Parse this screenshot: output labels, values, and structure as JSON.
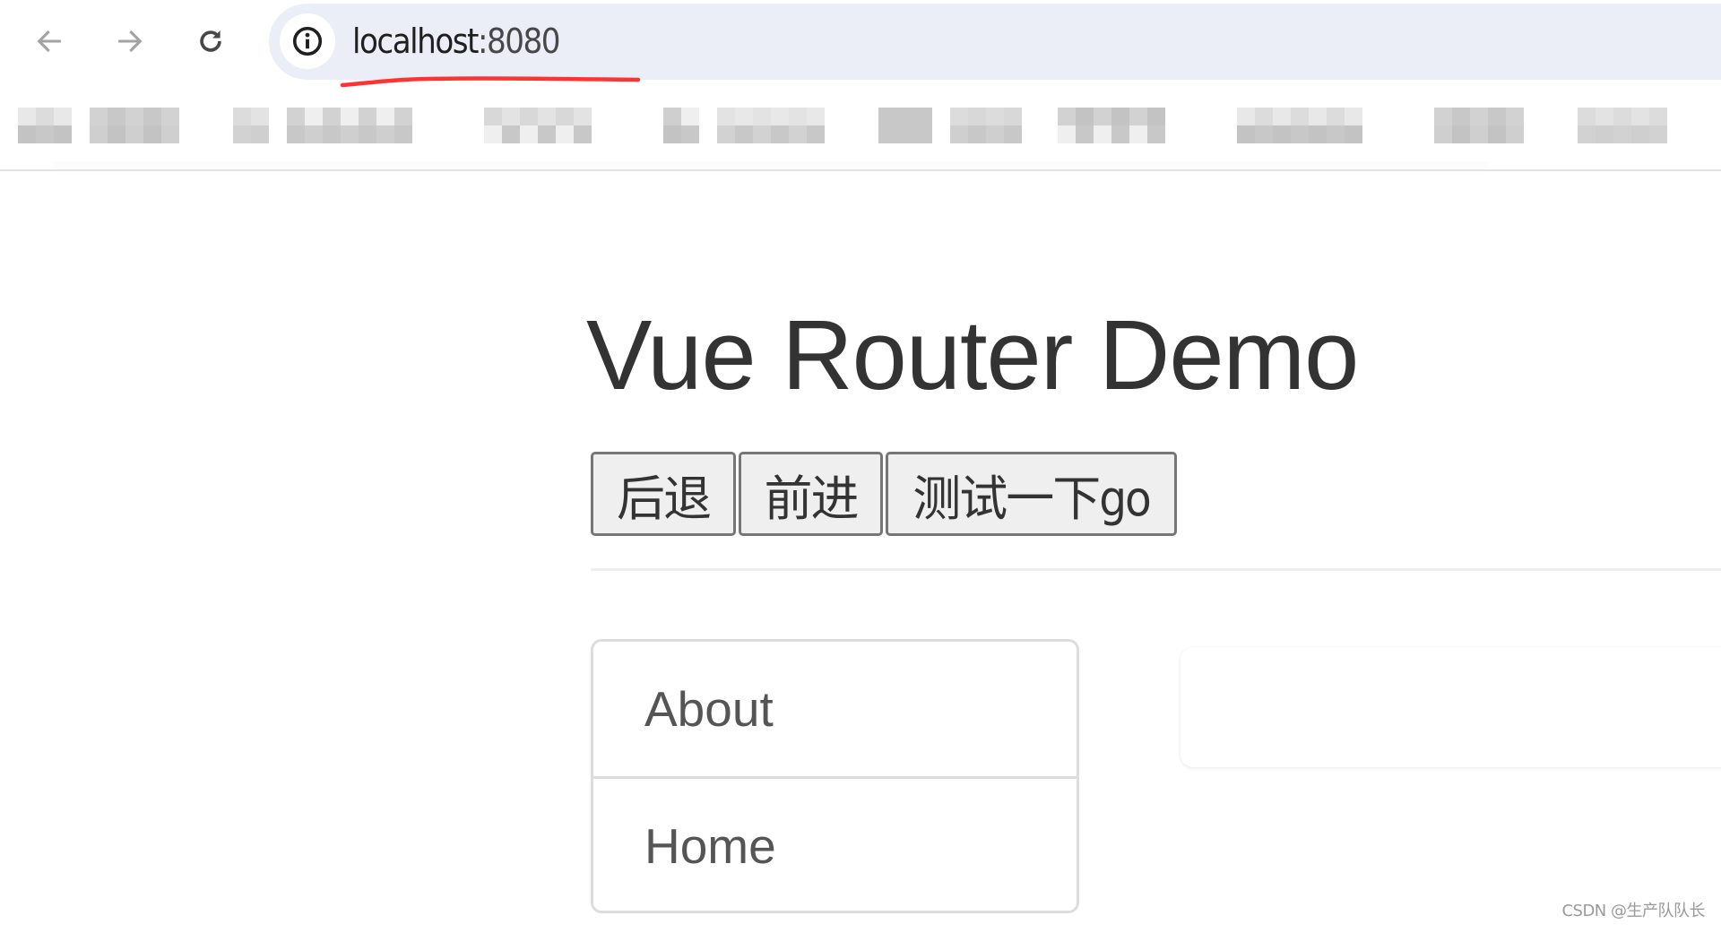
{
  "browser": {
    "nav": {
      "back_icon": "arrow-left-icon",
      "forward_icon": "arrow-right-icon",
      "reload_icon": "reload-icon"
    },
    "address_bar": {
      "site_info_icon": "info-circle-icon",
      "url_host": "localhost",
      "url_port": ":8080"
    },
    "annotation": {
      "underline_color": "#ff3333"
    },
    "bookmarks_blurred": true
  },
  "page": {
    "title": "Vue Router Demo",
    "buttons": [
      {
        "label": "后退"
      },
      {
        "label": "前进"
      },
      {
        "label": "测试一下go"
      }
    ],
    "nav_links": [
      {
        "label": "About"
      },
      {
        "label": "Home"
      }
    ]
  },
  "watermark": "CSDN @生产队队长",
  "colors": {
    "title": "#333333",
    "link_text": "#555555",
    "button_bg": "#efefef",
    "button_border": "#767676",
    "list_border": "#dddddd",
    "address_bar_bg": "#ebeef7"
  }
}
